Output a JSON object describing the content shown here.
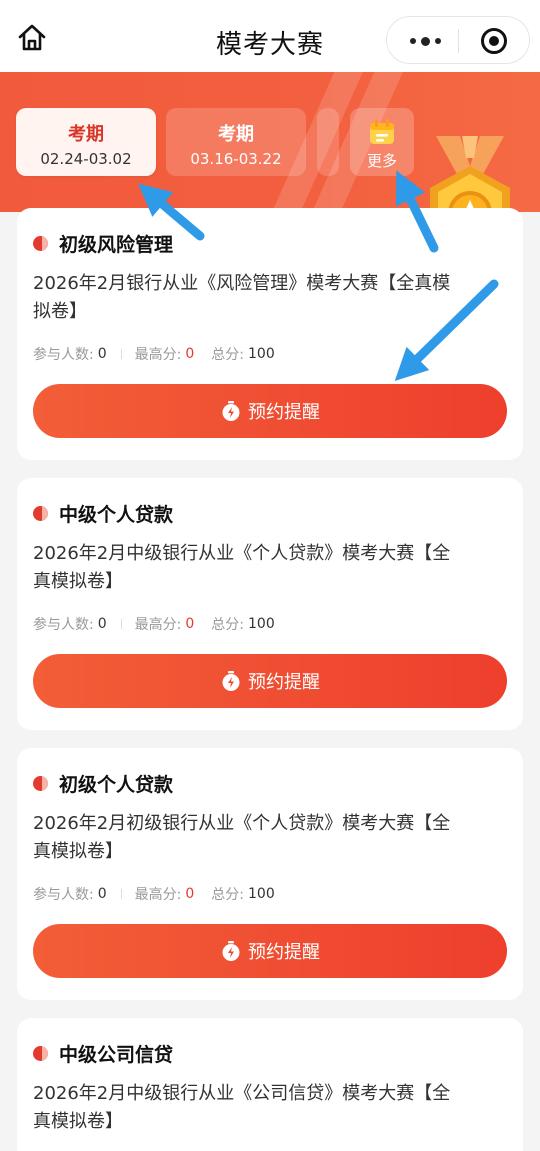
{
  "header": {
    "title": "模考大赛"
  },
  "banner": {
    "tabs": [
      {
        "label": "考期",
        "date": "02.24-03.02",
        "active": true
      },
      {
        "label": "考期",
        "date": "03.16-03.22",
        "active": false
      }
    ],
    "more_label": "更多"
  },
  "cards": [
    {
      "title": "初级风险管理",
      "desc": "2026年2月银行从业《风险管理》模考大赛【全真模拟卷】",
      "stats": {
        "participants_label": "参与人数:",
        "participants": "0",
        "max_label": "最高分:",
        "max": "0",
        "total_label": "总分:",
        "total": "100"
      },
      "button": "预约提醒"
    },
    {
      "title": "中级个人贷款",
      "desc": "2026年2月中级银行从业《个人贷款》模考大赛【全真模拟卷】",
      "stats": {
        "participants_label": "参与人数:",
        "participants": "0",
        "max_label": "最高分:",
        "max": "0",
        "total_label": "总分:",
        "total": "100"
      },
      "button": "预约提醒"
    },
    {
      "title": "初级个人贷款",
      "desc": "2026年2月初级银行从业《个人贷款》模考大赛【全真模拟卷】",
      "stats": {
        "participants_label": "参与人数:",
        "participants": "0",
        "max_label": "最高分:",
        "max": "0",
        "total_label": "总分:",
        "total": "100"
      },
      "button": "预约提醒"
    },
    {
      "title": "中级公司信贷",
      "desc": "2026年2月中级银行从业《公司信贷》模考大赛【全真模拟卷】"
    }
  ],
  "colors": {
    "accent": "#ee3f2d",
    "banner": "#f25a3c",
    "annotation_arrow": "#2f9be8"
  }
}
